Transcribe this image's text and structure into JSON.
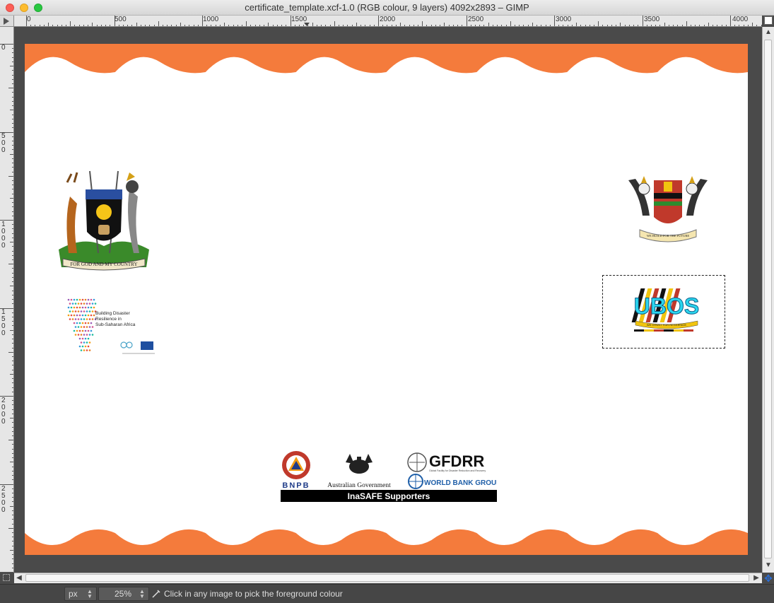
{
  "window": {
    "title": "certificate_template.xcf-1.0 (RGB colour, 9 layers) 4092x2893 – GIMP"
  },
  "rulers": {
    "horizontal_labels": [
      "0",
      "500",
      "1000",
      "1500",
      "2000",
      "2500",
      "3000",
      "3500",
      "4000"
    ],
    "vertical_labels": [
      "0",
      "500",
      "1000",
      "1500",
      "2000",
      "2500"
    ]
  },
  "image": {
    "left_logos": {
      "coat_of_arms_motto": "FOR GOD AND MY COUNTRY",
      "bdr_text_lines": [
        "Building Disaster",
        "Resilience in",
        "Sub-Saharan Africa"
      ]
    },
    "right_logos": {
      "university_motto": "WE BUILD FOR THE FUTURE",
      "ubos_name": "UBOS",
      "ubos_tagline": "WE COUNT FOR RESILIENCE"
    },
    "supporters": {
      "bnpb": "BNPB",
      "australia": "Australian Government",
      "gfdrr": "GFDRR",
      "gfdrr_sub": "Global Facility for Disaster Reduction and Recovery",
      "world_bank": "WORLD BANK GROUP",
      "banner": "InaSAFE Supporters"
    }
  },
  "status": {
    "unit": "px",
    "zoom": "25%",
    "message": "Click in any image to pick the foreground colour"
  },
  "colors": {
    "wave": "#f47b3c",
    "canvas_bg": "#4a4a4a",
    "ubos_cyan": "#2bd6ee"
  }
}
